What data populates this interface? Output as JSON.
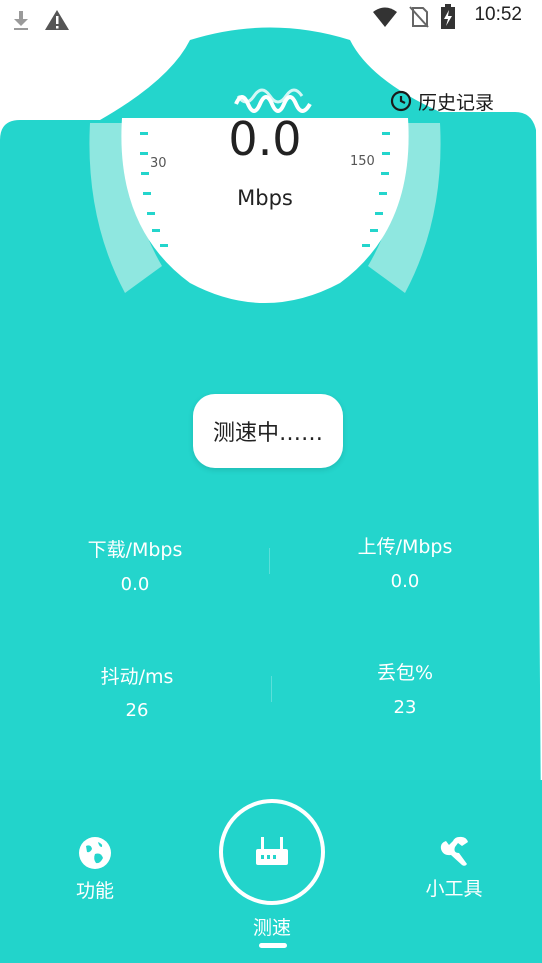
{
  "status_bar": {
    "time": "10:52",
    "left_icons": [
      "download-icon",
      "warning-icon"
    ],
    "right_icons": [
      "wifi-icon",
      "no-sim-icon",
      "battery-charging-icon"
    ]
  },
  "header": {
    "history_label": "历史记录",
    "history_icon": "clock-icon"
  },
  "gauge": {
    "value": "0.0",
    "unit": "Mbps",
    "tick_left": "30",
    "tick_right": "150"
  },
  "status": {
    "label": "测速中……"
  },
  "metrics": [
    {
      "label": "下载/Mbps",
      "value": "0.0"
    },
    {
      "label": "上传/Mbps",
      "value": "0.0"
    },
    {
      "label": "抖动/ms",
      "value": "26"
    },
    {
      "label": "丢包%",
      "value": "23"
    }
  ],
  "bottom_nav": {
    "left": {
      "label": "功能",
      "icon": "globe-icon"
    },
    "center": {
      "label": "测速",
      "icon": "router-icon"
    },
    "right": {
      "label": "小工具",
      "icon": "wrench-icon"
    }
  },
  "colors": {
    "accent": "#24d5cc",
    "bar_overlay": "#8fe7e0"
  }
}
